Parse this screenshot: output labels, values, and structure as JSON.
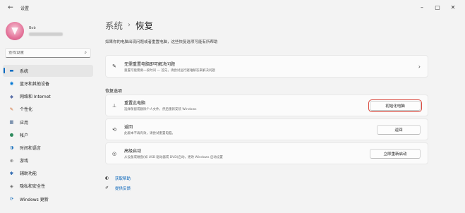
{
  "window": {
    "title": "设置",
    "back_icon": "back-arrow-icon",
    "controls": {
      "minimize": "–",
      "maximize": "▢",
      "close": "✕"
    }
  },
  "profile": {
    "name": "Bob"
  },
  "search": {
    "placeholder": "查找设置"
  },
  "sidebar": {
    "items": [
      {
        "label": "系统",
        "icon": "system-icon",
        "glyph": "▬",
        "color": "#0067c0",
        "active": true
      },
      {
        "label": "蓝牙和其他设备",
        "icon": "bluetooth-icon",
        "glyph": "◉",
        "color": "#0078d4",
        "active": false
      },
      {
        "label": "网络和 Internet",
        "icon": "network-icon",
        "glyph": "◆",
        "color": "#5a6fa8",
        "active": false
      },
      {
        "label": "个性化",
        "icon": "personalization-icon",
        "glyph": "✎",
        "color": "#d0682c",
        "active": false
      },
      {
        "label": "应用",
        "icon": "apps-icon",
        "glyph": "▦",
        "color": "#4a6a92",
        "active": false
      },
      {
        "label": "帐户",
        "icon": "accounts-icon",
        "glyph": "●",
        "color": "#2f8b5e",
        "active": false
      },
      {
        "label": "时间和语言",
        "icon": "time-language-icon",
        "glyph": "◑",
        "color": "#2a7ac0",
        "active": false
      },
      {
        "label": "游戏",
        "icon": "gaming-icon",
        "glyph": "⊕",
        "color": "#6a6a6a",
        "active": false
      },
      {
        "label": "辅助功能",
        "icon": "accessibility-icon",
        "glyph": "✱",
        "color": "#2a66b0",
        "active": false
      },
      {
        "label": "隐私和安全性",
        "icon": "privacy-icon",
        "glyph": "◈",
        "color": "#6b6b6b",
        "active": false
      },
      {
        "label": "Windows 更新",
        "icon": "windows-update-icon",
        "glyph": "⟳",
        "color": "#2a7ac0",
        "active": false
      }
    ]
  },
  "main": {
    "breadcrumb": {
      "parent": "系统",
      "separator": "›",
      "current": "恢复"
    },
    "description": "如果你的电脑出现问题或者重置电脑，这些恢复选项可能有所帮助",
    "troubleshoot": {
      "title": "无需重置电脑即可解决问题",
      "subtitle": "重置可能需要一段时间 — 首先，请尝试运行疑难解答来解决问题",
      "chevron": "›"
    },
    "section_title": "恢复选项",
    "options": [
      {
        "title": "重置此电脑",
        "subtitle": "选择保留或删除个人文件，然后重新安装 Windows",
        "button": "初始化电脑",
        "icon": "reset-pc-icon",
        "glyph": "⊥"
      },
      {
        "title": "返回",
        "subtitle": "此版本不再有效，请尝试重置电脑。",
        "button": "返回",
        "icon": "go-back-icon",
        "glyph": "⟲"
      },
      {
        "title": "高级启动",
        "subtitle": "从设备或磁盘(如 USB 驱动器或 DVD)启动，更改 Windows 启动设置",
        "button": "立即重新启动",
        "icon": "advanced-startup-icon",
        "glyph": "◎"
      }
    ],
    "links": [
      {
        "label": "获取帮助",
        "icon": "help-icon",
        "glyph": "◐"
      },
      {
        "label": "提供反馈",
        "icon": "feedback-icon",
        "glyph": "✐"
      }
    ]
  }
}
